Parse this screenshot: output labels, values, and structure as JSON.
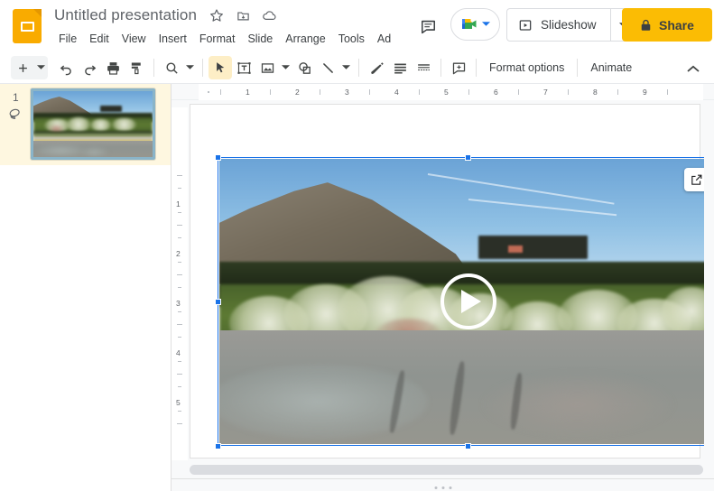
{
  "header": {
    "doc_icon": "slides-app-icon",
    "title": "Untitled presentation",
    "star_icon": "star-icon",
    "move_icon": "move-to-folder-icon",
    "cloud_icon": "cloud-saved-icon",
    "menus": [
      "File",
      "Edit",
      "View",
      "Insert",
      "Format",
      "Slide",
      "Arrange",
      "Tools",
      "Ad"
    ],
    "comment_icon": "comment-history-icon",
    "meet_icon": "google-meet-icon",
    "meet_caret_icon": "chevron-down-icon",
    "slideshow_label": "Slideshow",
    "slideshow_icon": "present-play-icon",
    "slideshow_caret_icon": "chevron-down-icon",
    "share_label": "Share",
    "share_icon": "lock-icon"
  },
  "toolbar": {
    "new_slide_icon": "plus-icon",
    "new_slide_caret_icon": "chevron-down-icon",
    "undo_icon": "undo-icon",
    "redo_icon": "redo-icon",
    "print_icon": "print-icon",
    "paint_format_icon": "paint-format-icon",
    "zoom_icon": "zoom-icon",
    "zoom_caret_icon": "chevron-down-icon",
    "select_icon": "cursor-select-icon",
    "textbox_icon": "text-box-icon",
    "image_icon": "insert-image-icon",
    "image_caret_icon": "chevron-down-icon",
    "shape_icon": "shape-icon",
    "line_icon": "line-icon",
    "line_caret_icon": "chevron-down-icon",
    "pen_icon": "pen-icon",
    "align_icon": "align-icon",
    "line_spacing_icon": "line-spacing-icon",
    "comment_add_icon": "add-comment-icon",
    "format_options_label": "Format options",
    "animate_label": "Animate",
    "collapse_icon": "chevron-up-icon"
  },
  "filmstrip": {
    "slides": [
      {
        "number": "1",
        "transition_icon": "transition-layers-icon",
        "selected": true
      }
    ]
  },
  "canvas": {
    "ruler_h": {
      "labels": [
        "1",
        "2",
        "3",
        "4",
        "5",
        "6",
        "7",
        "8",
        "9"
      ]
    },
    "ruler_v": {
      "labels": [
        "1",
        "2",
        "3",
        "4",
        "5"
      ]
    },
    "video_object": {
      "name": "video-placeholder",
      "selected": true,
      "play_icon": "play-circle-icon",
      "popout_icon": "open-in-new-icon",
      "handles": 8
    },
    "hscroll_icon": "horizontal-scrollbar",
    "grip_icon": "panel-resize-grip"
  },
  "colors": {
    "brand_yellow": "#f9ab00",
    "share_yellow": "#fbbc04",
    "selection_blue": "#1a73e8",
    "selected_slide_bg": "#fef7e0",
    "canvas_bg": "#f8f9fa",
    "text_gray": "#3c4043"
  }
}
